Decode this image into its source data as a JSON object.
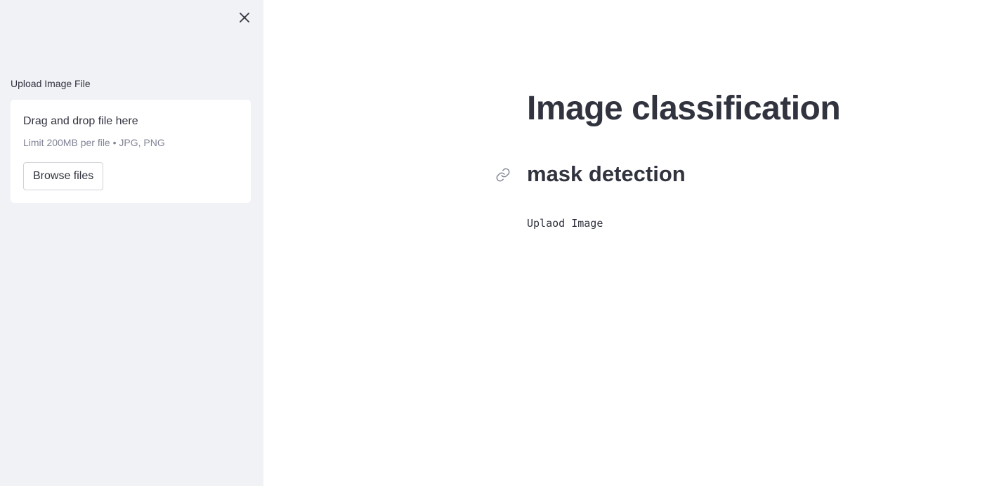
{
  "sidebar": {
    "close_icon": "close-icon",
    "uploader": {
      "label": "Upload Image File",
      "instructions": "Drag and drop file here",
      "limit_text": "Limit 200MB per file • JPG, PNG",
      "browse_label": "Browse files"
    }
  },
  "main": {
    "title": "Image classification",
    "subheader": "mask detection",
    "anchor_icon": "link-icon",
    "text": "Uplaod Image"
  },
  "colors": {
    "sidebar_bg": "#f0f2f6",
    "text": "#31333f",
    "muted": "#808495"
  }
}
